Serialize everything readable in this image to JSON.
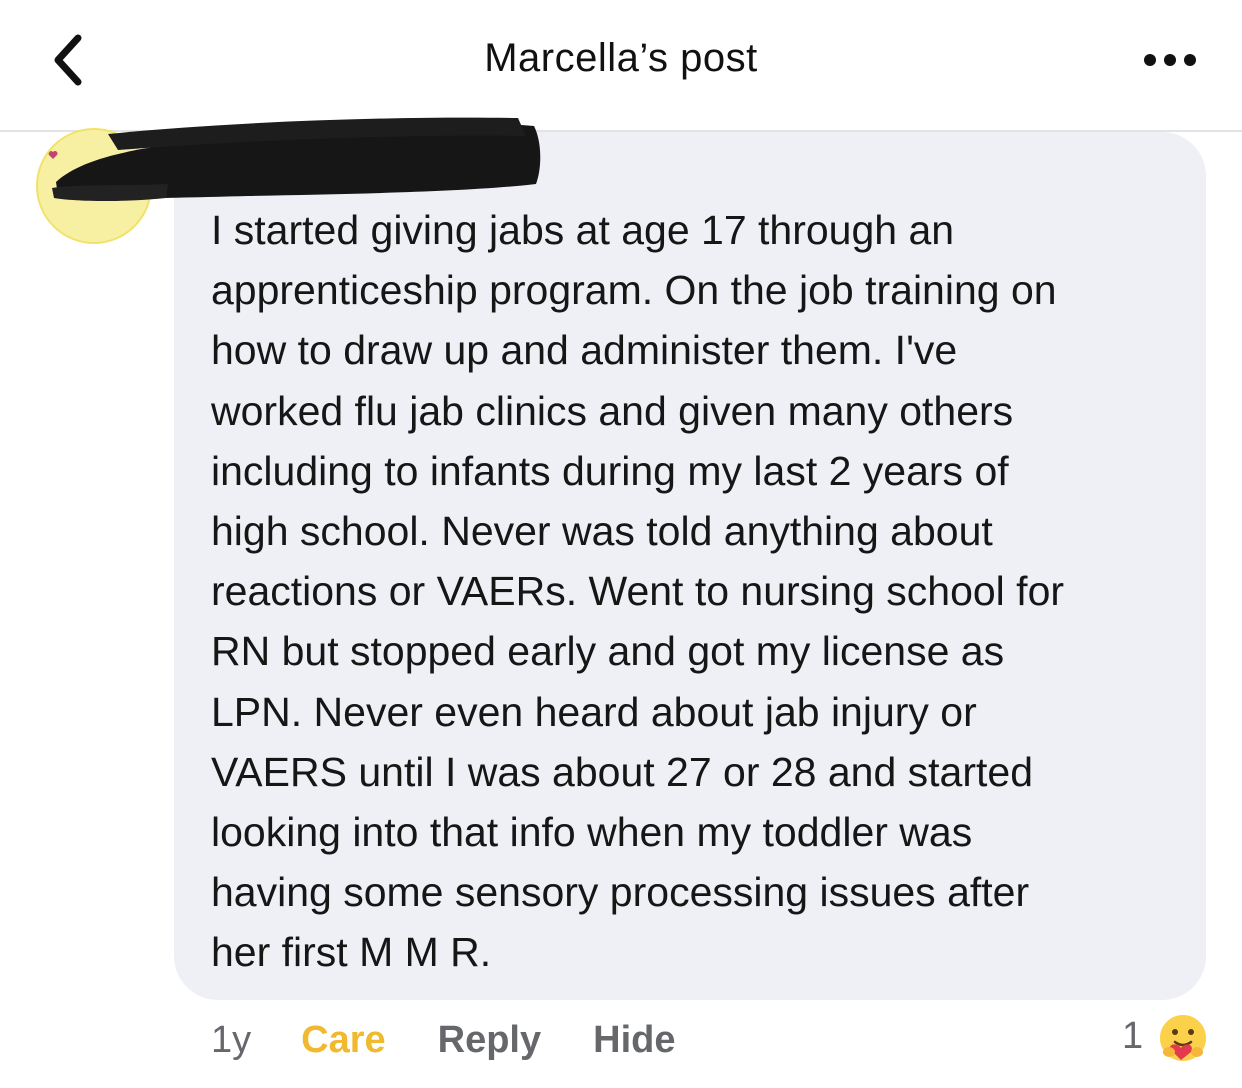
{
  "header": {
    "title": "Marcella’s post",
    "back_icon": "chevron-left-icon",
    "more_icon": "more-horizontal-icon"
  },
  "comment": {
    "text": "I started giving jabs at age 17 through an apprenticeship program. On the job training on how to draw up and administer them. I've worked flu jab clinics and given many others including to infants during my last 2 years of high school. Never was told anything about reactions or VAERs. Went to nursing school for RN but stopped early and got my license as LPN. Never even heard about jab injury or VAERS until I was about 27 or 28 and started looking into that info when my toddler was having some sensory processing issues after her first M M R.",
    "lines": [
      "I started giving jabs at age 17 through an",
      "apprenticeship program. On the job training on",
      "how to draw up and administer them. I've",
      "worked flu jab clinics and given many others",
      "including to infants during my last 2 years of",
      "high school. Never was told anything about",
      "reactions or VAERs. Went to nursing school for",
      "RN but stopped early and got my license as",
      "LPN. Never even heard about jab injury or",
      "VAERS until I was about 27 or 28 and started",
      "looking into that info when my toddler was",
      "having some sensory processing issues after",
      "her first M M R."
    ]
  },
  "actions": {
    "time": "1y",
    "care_label": "Care",
    "reply_label": "Reply",
    "hide_label": "Hide"
  },
  "reactions": {
    "count": "1",
    "icon": "care-reaction-icon"
  },
  "colors": {
    "care": "#f0b92e",
    "muted": "#65676b",
    "bubble": "#eef0f5",
    "avatar_ring": "#f7f0a2"
  }
}
